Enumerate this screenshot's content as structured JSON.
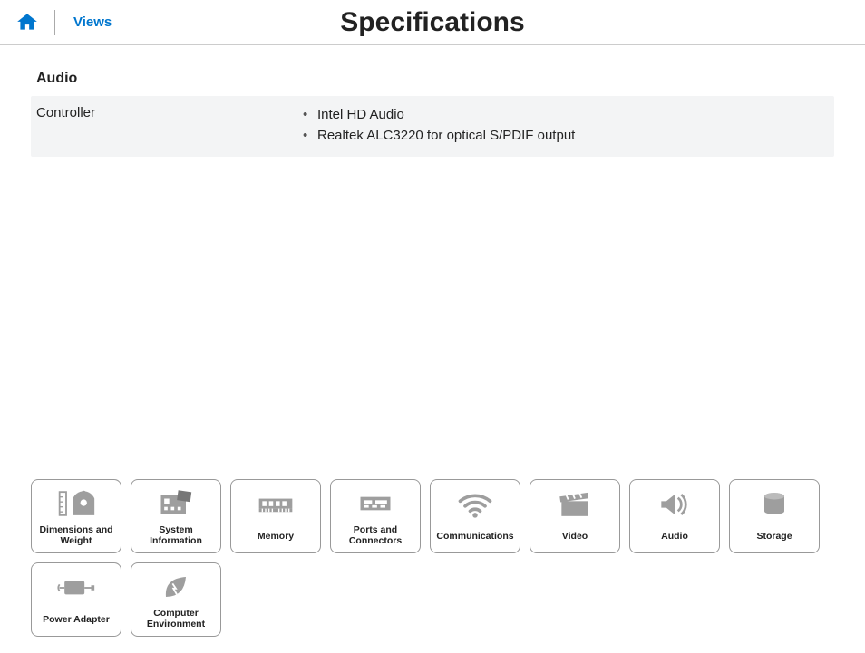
{
  "header": {
    "views_label": "Views",
    "page_title": "Specifications"
  },
  "section": {
    "title": "Audio",
    "row_label": "Controller",
    "row_values": [
      "Intel HD Audio",
      "Realtek ALC3220 for optical S/PDIF output"
    ]
  },
  "tiles": [
    {
      "id": "dimensions",
      "label": "Dimensions and\nWeight"
    },
    {
      "id": "sysinfo",
      "label": "System\nInformation"
    },
    {
      "id": "memory",
      "label": "Memory"
    },
    {
      "id": "ports",
      "label": "Ports and\nConnectors"
    },
    {
      "id": "comm",
      "label": "Communications"
    },
    {
      "id": "video",
      "label": "Video"
    },
    {
      "id": "audio",
      "label": "Audio"
    },
    {
      "id": "storage",
      "label": "Storage"
    },
    {
      "id": "power",
      "label": "Power Adapter"
    },
    {
      "id": "env",
      "label": "Computer\nEnvironment"
    }
  ]
}
